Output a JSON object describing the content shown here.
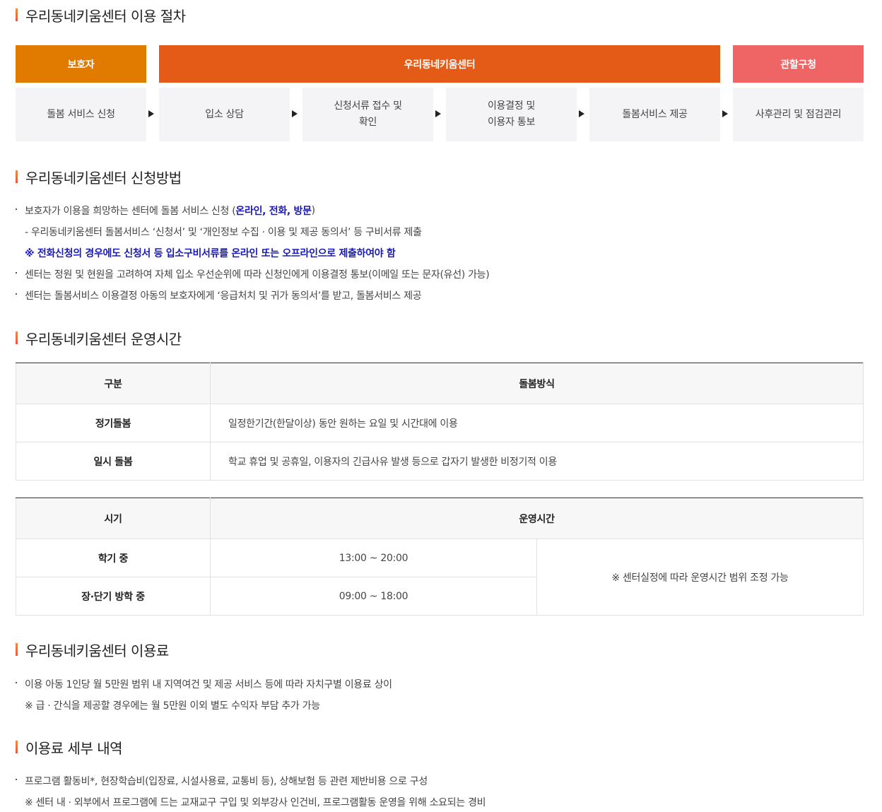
{
  "sections": {
    "procedure": "우리동네키움센터 이용 절차",
    "method": "우리동네키움센터 신청방법",
    "hours": "우리동네키움센터 운영시간",
    "fee": "우리동네키움센터 이용료",
    "fee_detail": "이용료 세부 내역"
  },
  "procedure": {
    "groups": [
      "보호자",
      "우리동네키움센터",
      "관할구청"
    ],
    "group_colors": [
      "#e07b00",
      "#e35b16",
      "#ef6565"
    ],
    "steps": [
      [
        "돌봄 서비스 신청"
      ],
      [
        "입소 상담"
      ],
      [
        "신청서류 접수 및",
        "확인"
      ],
      [
        "이용결정 및",
        "이용자 통보"
      ],
      [
        "돌봄서비스 제공"
      ],
      [
        "사후관리 및 점검관리"
      ]
    ]
  },
  "method": {
    "l1a": "보호자가 이용을 희망하는 센터에 돌봄 서비스 신청 (",
    "l1b": "온라인, 전화, 방문",
    "l1c": ")",
    "l2": "- 우리동네키움센터 돌봄서비스 ‘신청서’ 및 ‘개인정보 수집 · 이용 및 제공 동의서’ 등 구비서류 제출",
    "l3": "※ 전화신청의 경우에도 신청서 등 입소구비서류를 온라인 또는 오프라인으로 제출하여야 함",
    "l4": "센터는 정원 및 현원을 고려하여 자체 입소 우선순위에 따라 신청인에게 이용결정 통보(이메일 또는 문자(유선) 가능)",
    "l5": "센터는 돌봄서비스 이용결정 아동의 보호자에게 ‘응급처치 및 귀가 동의서’를 받고, 돌봄서비스 제공"
  },
  "table1": {
    "h1": "구분",
    "h2": "돌봄방식",
    "r1a": "정기돌봄",
    "r1b": "일정한기간(한달이상) 동안 원하는 요일 및 시간대에 이용",
    "r2a": "일시 돌봄",
    "r2b": "학교 휴업 및 공휴일, 이용자의 긴급사유 발생 등으로 갑자기 발생한 비정기적 이용"
  },
  "table2": {
    "h1": "시기",
    "h2": "운영시간",
    "r1a": "학기 중",
    "r1b": "13:00 ~ 20:00",
    "r2a": "장·단기 방학 중",
    "r2b": "09:00 ~ 18:00",
    "note": "※ 센터실정에 따라 운영시간 범위 조정 가능"
  },
  "fee": {
    "l1": "이용 아동 1인당 월 5만원 범위 내 지역여건 및 제공 서비스 등에 따라 자치구별 이용료 상이",
    "l2": "※ 급 · 간식을 제공할 경우에는 월 5만원 이외 별도 수익자 부담 추가 가능"
  },
  "fee_detail": {
    "l1": "프로그램 활동비*, 현장학습비(입장료, 시설사용료, 교통비 등), 상해보험 등 관련 제반비용 으로 구성",
    "l2": "※ 센터 내 · 외부에서 프로그램에 드는 교재교구 구입 및 외부강사 인건비, 프로그램활동 운영을 위해 소요되는 경비"
  }
}
